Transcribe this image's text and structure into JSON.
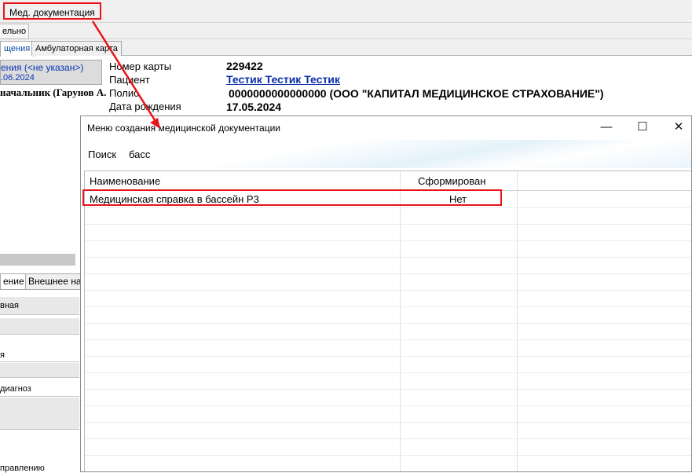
{
  "menubar": {
    "med_docs": "Мед. документация"
  },
  "toolbar": {
    "partial_button": "ельно"
  },
  "tabs": [
    {
      "label": "щения"
    },
    {
      "label": "Амбулаторная карта"
    }
  ],
  "left_panel": {
    "line1": "ения (<не указан>)",
    "line2": ".06.2024",
    "doctor": "начальник (Гарунов А.",
    "tabs": [
      {
        "label": "ение"
      },
      {
        "label": "Внешнее на"
      }
    ],
    "rows": [
      {
        "label": "вная"
      },
      {
        "label": ""
      },
      {
        "label": "я"
      },
      {
        "label": ""
      },
      {
        "label": "диагноз"
      },
      {
        "label": ""
      },
      {
        "label": "правлению"
      }
    ]
  },
  "patient": {
    "card_label": "Номер карты",
    "card_value": "229422",
    "patient_label": "Пациент",
    "patient_value": "Тестик Тестик Тестик",
    "policy_label": "Полис",
    "policy_value": "0000000000000000 (ООО \"КАПИТАЛ МЕДИЦИНСКОЕ СТРАХОВАНИЕ\")",
    "dob_label": "Дата рождения",
    "dob_value": "17.05.2024"
  },
  "dialog": {
    "title": "Меню создания медицинской документации",
    "minimize": "—",
    "maximize": "☐",
    "close": "✕",
    "search_label": "Поиск",
    "search_value": "басс",
    "columns": {
      "name": "Наименование",
      "formed": "Сформирован"
    },
    "rows": [
      {
        "name": "Медицинская справка в бассейн Р3",
        "formed": "Нет"
      }
    ]
  },
  "colors": {
    "annotation": "#e8141c",
    "link": "#0b2ea8"
  }
}
